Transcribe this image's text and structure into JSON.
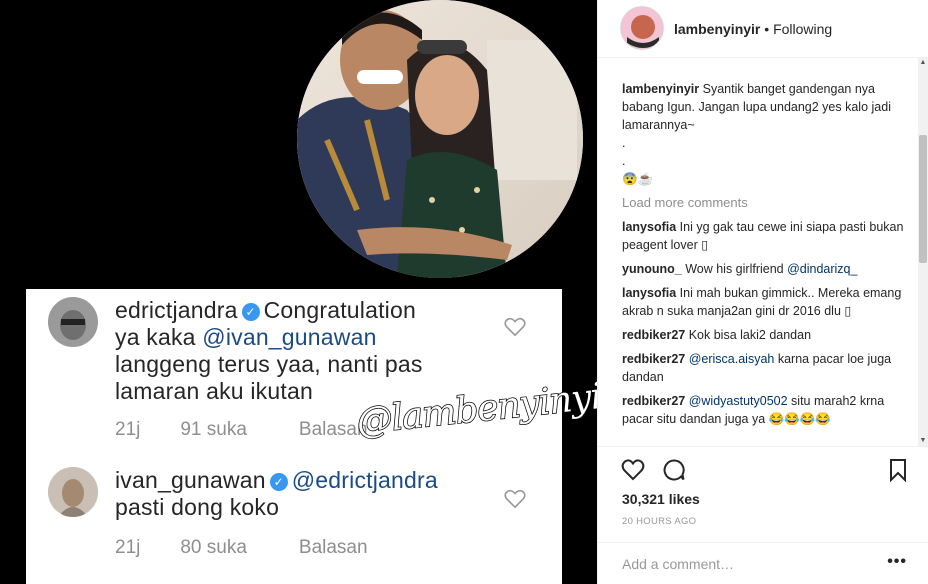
{
  "header": {
    "username": "lambenyinyir",
    "separator": "•",
    "follow_state": "Following"
  },
  "image_card": {
    "comment1": {
      "username": "edrictjandra",
      "text_line1": "Congratulation",
      "text_line2_prefix": "ya kaka ",
      "mention": "@ivan_gunawan",
      "text_line3": "langgeng terus yaa, nanti pas",
      "text_line4": "lamaran aku ikutan",
      "time": "21j",
      "likes": "91 suka",
      "reply": "Balasan"
    },
    "comment2": {
      "username": "ivan_gunawan",
      "mention": "@edrictjandra",
      "text": "pasti dong koko",
      "time": "21j",
      "likes": "80 suka",
      "reply": "Balasan"
    },
    "watermark": "@lambenyinyir"
  },
  "caption": {
    "username": "lambenyinyir",
    "text": "Syantik banget gandengan nya babang Igun. Jangan lupa undang2 yes kalo jadi lamarannya~",
    "line_dot1": ".",
    "line_dot2": ".",
    "emoji": "😨☕"
  },
  "load_more": "Load more comments",
  "comments": [
    {
      "username": "lanysofia",
      "text": "Ini yg gak tau cewe ini siapa pasti bukan peagent lover ▯",
      "mention": ""
    },
    {
      "username": "yunouno_",
      "text": "Wow his girlfriend ",
      "mention": "@dindarizq_"
    },
    {
      "username": "lanysofia",
      "text": "Ini mah bukan gimmick.. Mereka emang akrab n suka manja2an gini dr 2016 dlu ▯",
      "mention": ""
    },
    {
      "username": "redbiker27",
      "text": "Kok bisa laki2 dandan",
      "mention": ""
    },
    {
      "username": "redbiker27",
      "mention": "@erisca.aisyah",
      "text": " karna pacar loe juga dandan"
    },
    {
      "username": "redbiker27",
      "mention": "@widyastuty0502",
      "text": " situ marah2 krna pacar situ dandan juga ya 😂😂😂😂"
    }
  ],
  "likes": "30,321 likes",
  "time_ago": "20 HOURS AGO",
  "add_comment_placeholder": "Add a comment…",
  "more_options": "•••"
}
